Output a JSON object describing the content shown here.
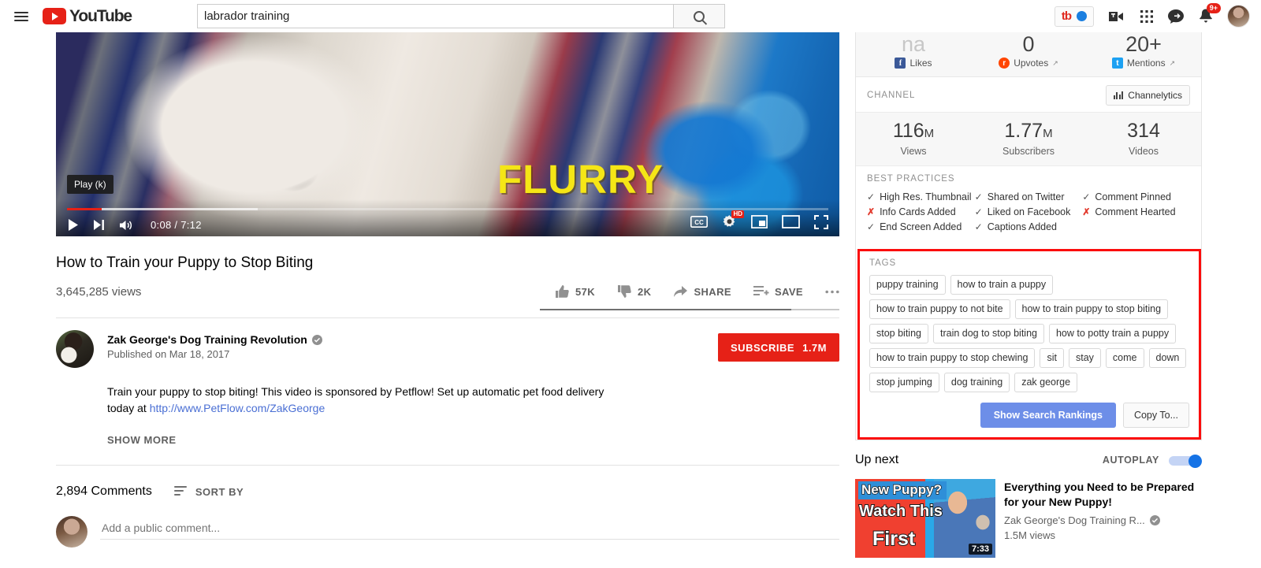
{
  "masthead": {
    "guide_label": "Guide",
    "logo_text": "YouTube",
    "search": {
      "value": "labrador training",
      "placeholder": "Search"
    },
    "tubebuddy_label": "tb",
    "notifications_badge": "9+"
  },
  "player": {
    "tooltip": "Play (k)",
    "overlay_text": "FLURRY",
    "current_time": "0:08",
    "total_time": "7:12",
    "time_display": "0:08 / 7:12",
    "quality_badge": "HD",
    "cc_label": "CC"
  },
  "video": {
    "title": "How to Train your Puppy to Stop Biting",
    "views": "3,645,285 views",
    "likes": "57K",
    "dislikes": "2K",
    "share_label": "SHARE",
    "save_label": "SAVE",
    "more_label": "•••"
  },
  "channel": {
    "name": "Zak George's Dog Training Revolution",
    "published": "Published on Mar 18, 2017",
    "subscribe_label": "SUBSCRIBE",
    "subscriber_count": "1.7M",
    "description_line1": "Train your puppy to stop biting! This video is sponsored by Petflow! Set up automatic pet food delivery",
    "description_line2_prefix": "today at ",
    "description_link": "http://www.PetFlow.com/ZakGeorge",
    "show_more_label": "SHOW MORE"
  },
  "comments": {
    "count_label": "2,894 Comments",
    "sort_label": "SORT BY",
    "add_placeholder": "Add a public comment..."
  },
  "tubebuddy": {
    "social": [
      {
        "value": "na",
        "label": "Likes",
        "icon": "facebook-icon",
        "color": "#3b5998",
        "external": false
      },
      {
        "value": "0",
        "label": "Upvotes",
        "icon": "reddit-icon",
        "color": "#ff4500",
        "external": true
      },
      {
        "value": "20+",
        "label": "Mentions",
        "icon": "twitter-icon",
        "color": "#1da1f2",
        "external": true
      }
    ],
    "channel_section_title": "CHANNEL",
    "channelytics_label": "Channelytics",
    "channel_stats": [
      {
        "value": "116",
        "unit": "M",
        "label": "Views"
      },
      {
        "value": "1.77",
        "unit": "M",
        "label": "Subscribers"
      },
      {
        "value": "314",
        "unit": "",
        "label": "Videos"
      }
    ],
    "best_practices_title": "BEST PRACTICES",
    "best_practices": [
      [
        {
          "label": "High Res. Thumbnail",
          "done": true
        },
        {
          "label": "Info Cards Added",
          "done": false
        },
        {
          "label": "End Screen Added",
          "done": true
        }
      ],
      [
        {
          "label": "Shared on Twitter",
          "done": true
        },
        {
          "label": "Liked on Facebook",
          "done": true
        },
        {
          "label": "Captions Added",
          "done": true
        }
      ],
      [
        {
          "label": "Comment Pinned",
          "done": true
        },
        {
          "label": "Comment Hearted",
          "done": false
        }
      ]
    ],
    "tags_title": "TAGS",
    "tags": [
      "puppy training",
      "how to train a puppy",
      "how to train puppy to not bite",
      "how to train puppy to stop biting",
      "stop biting",
      "train dog to stop biting",
      "how to potty train a puppy",
      "how to train puppy to stop chewing",
      "sit",
      "stay",
      "come",
      "down",
      "stop jumping",
      "dog training",
      "zak george"
    ],
    "show_rankings_label": "Show Search Rankings",
    "copy_to_label": "Copy To...",
    "highlight_color": "#fb0d0d",
    "primary_button_color": "#6d8ee8"
  },
  "upnext": {
    "title": "Up next",
    "autoplay_label": "AUTOPLAY",
    "autoplay_on": true,
    "item": {
      "title": "Everything you Need to be Prepared for your New Puppy!",
      "channel": "Zak George's Dog Training R...",
      "views": "1.5M views",
      "duration": "7:33",
      "thumb_line1": "New Puppy?",
      "thumb_line2": "Watch This",
      "thumb_line3": "First"
    }
  }
}
